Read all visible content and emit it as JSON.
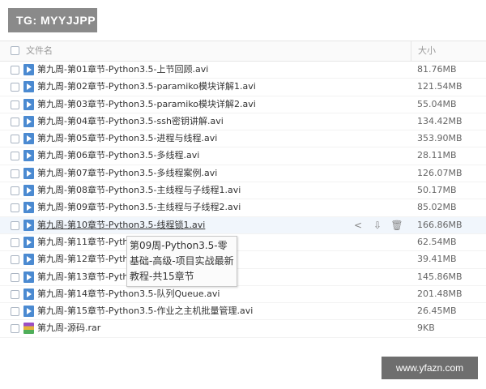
{
  "badge": "TG: MYYJJPP",
  "header": {
    "name_label": "文件名",
    "size_label": "大小"
  },
  "files": [
    {
      "name": "第九周-第01章节-Python3.5-上节回顾.avi",
      "size": "81.76MB",
      "type": "video"
    },
    {
      "name": "第九周-第02章节-Python3.5-paramiko模块详解1.avi",
      "size": "121.54MB",
      "type": "video"
    },
    {
      "name": "第九周-第03章节-Python3.5-paramiko模块详解2.avi",
      "size": "55.04MB",
      "type": "video"
    },
    {
      "name": "第九周-第04章节-Python3.5-ssh密钥讲解.avi",
      "size": "134.42MB",
      "type": "video"
    },
    {
      "name": "第九周-第05章节-Python3.5-进程与线程.avi",
      "size": "353.90MB",
      "type": "video"
    },
    {
      "name": "第九周-第06章节-Python3.5-多线程.avi",
      "size": "28.11MB",
      "type": "video"
    },
    {
      "name": "第九周-第07章节-Python3.5-多线程案例.avi",
      "size": "126.07MB",
      "type": "video"
    },
    {
      "name": "第九周-第08章节-Python3.5-主线程与子线程1.avi",
      "size": "50.17MB",
      "type": "video"
    },
    {
      "name": "第九周-第09章节-Python3.5-主线程与子线程2.avi",
      "size": "85.02MB",
      "type": "video"
    },
    {
      "name": "第九周-第10章节-Python3.5-线程锁1.avi",
      "size": "166.86MB",
      "type": "video",
      "hover": true
    },
    {
      "name": "第九周-第11章节-Python3.5-",
      "size": "62.54MB",
      "type": "video"
    },
    {
      "name": "第九周-第12章节-Pytho",
      "size": "39.41MB",
      "type": "video"
    },
    {
      "name": "第九周-第13章节-Pytho",
      "size": "145.86MB",
      "type": "video"
    },
    {
      "name": "第九周-第14章节-Python3.5-队列Queue.avi",
      "size": "201.48MB",
      "type": "video"
    },
    {
      "name": "第九周-第15章节-Python3.5-作业之主机批量管理.avi",
      "size": "26.45MB",
      "type": "video"
    },
    {
      "name": "第九周-源码.rar",
      "size": "9KB",
      "type": "rar"
    }
  ],
  "row_actions": [
    {
      "icon": "share-icon",
      "glyph": "<"
    },
    {
      "icon": "download-icon",
      "glyph": "⇩"
    },
    {
      "icon": "delete-icon",
      "glyph": "🗑"
    }
  ],
  "tooltip": "第09周-Python3.5-零基础-高级-项目实战最新教程-共15章节",
  "watermark": "www.yfazn.com"
}
